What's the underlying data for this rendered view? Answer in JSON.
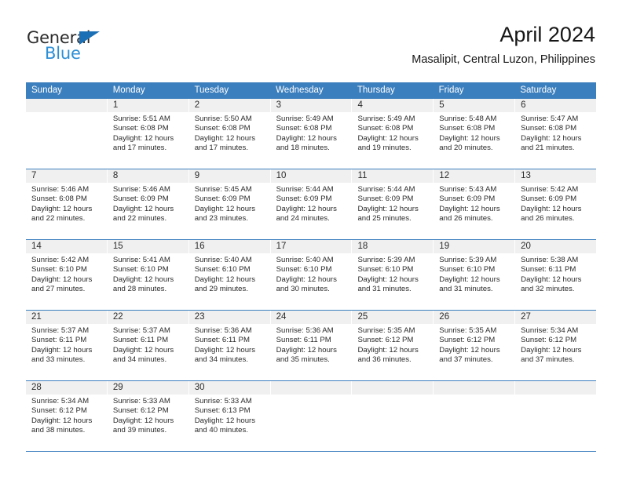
{
  "brand": {
    "name_dark": "General",
    "name_blue": "Blue",
    "accent_blue": "#2d8fd5",
    "triangle_blue": "#1a6fb5"
  },
  "header": {
    "title": "April 2024",
    "subtitle": "Masalipit, Central Luzon, Philippines"
  },
  "calendar": {
    "header_color": "#3c7fbe",
    "day_band_color": "#f0f0f0",
    "day_names": [
      "Sunday",
      "Monday",
      "Tuesday",
      "Wednesday",
      "Thursday",
      "Friday",
      "Saturday"
    ],
    "weeks": [
      [
        {
          "day": "",
          "empty": true,
          "sunrise": "",
          "sunset": "",
          "daylight": ""
        },
        {
          "day": "1",
          "empty": false,
          "sunrise": "Sunrise: 5:51 AM",
          "sunset": "Sunset: 6:08 PM",
          "daylight": "Daylight: 12 hours and 17 minutes."
        },
        {
          "day": "2",
          "empty": false,
          "sunrise": "Sunrise: 5:50 AM",
          "sunset": "Sunset: 6:08 PM",
          "daylight": "Daylight: 12 hours and 17 minutes."
        },
        {
          "day": "3",
          "empty": false,
          "sunrise": "Sunrise: 5:49 AM",
          "sunset": "Sunset: 6:08 PM",
          "daylight": "Daylight: 12 hours and 18 minutes."
        },
        {
          "day": "4",
          "empty": false,
          "sunrise": "Sunrise: 5:49 AM",
          "sunset": "Sunset: 6:08 PM",
          "daylight": "Daylight: 12 hours and 19 minutes."
        },
        {
          "day": "5",
          "empty": false,
          "sunrise": "Sunrise: 5:48 AM",
          "sunset": "Sunset: 6:08 PM",
          "daylight": "Daylight: 12 hours and 20 minutes."
        },
        {
          "day": "6",
          "empty": false,
          "sunrise": "Sunrise: 5:47 AM",
          "sunset": "Sunset: 6:08 PM",
          "daylight": "Daylight: 12 hours and 21 minutes."
        }
      ],
      [
        {
          "day": "7",
          "empty": false,
          "sunrise": "Sunrise: 5:46 AM",
          "sunset": "Sunset: 6:08 PM",
          "daylight": "Daylight: 12 hours and 22 minutes."
        },
        {
          "day": "8",
          "empty": false,
          "sunrise": "Sunrise: 5:46 AM",
          "sunset": "Sunset: 6:09 PM",
          "daylight": "Daylight: 12 hours and 22 minutes."
        },
        {
          "day": "9",
          "empty": false,
          "sunrise": "Sunrise: 5:45 AM",
          "sunset": "Sunset: 6:09 PM",
          "daylight": "Daylight: 12 hours and 23 minutes."
        },
        {
          "day": "10",
          "empty": false,
          "sunrise": "Sunrise: 5:44 AM",
          "sunset": "Sunset: 6:09 PM",
          "daylight": "Daylight: 12 hours and 24 minutes."
        },
        {
          "day": "11",
          "empty": false,
          "sunrise": "Sunrise: 5:44 AM",
          "sunset": "Sunset: 6:09 PM",
          "daylight": "Daylight: 12 hours and 25 minutes."
        },
        {
          "day": "12",
          "empty": false,
          "sunrise": "Sunrise: 5:43 AM",
          "sunset": "Sunset: 6:09 PM",
          "daylight": "Daylight: 12 hours and 26 minutes."
        },
        {
          "day": "13",
          "empty": false,
          "sunrise": "Sunrise: 5:42 AM",
          "sunset": "Sunset: 6:09 PM",
          "daylight": "Daylight: 12 hours and 26 minutes."
        }
      ],
      [
        {
          "day": "14",
          "empty": false,
          "sunrise": "Sunrise: 5:42 AM",
          "sunset": "Sunset: 6:10 PM",
          "daylight": "Daylight: 12 hours and 27 minutes."
        },
        {
          "day": "15",
          "empty": false,
          "sunrise": "Sunrise: 5:41 AM",
          "sunset": "Sunset: 6:10 PM",
          "daylight": "Daylight: 12 hours and 28 minutes."
        },
        {
          "day": "16",
          "empty": false,
          "sunrise": "Sunrise: 5:40 AM",
          "sunset": "Sunset: 6:10 PM",
          "daylight": "Daylight: 12 hours and 29 minutes."
        },
        {
          "day": "17",
          "empty": false,
          "sunrise": "Sunrise: 5:40 AM",
          "sunset": "Sunset: 6:10 PM",
          "daylight": "Daylight: 12 hours and 30 minutes."
        },
        {
          "day": "18",
          "empty": false,
          "sunrise": "Sunrise: 5:39 AM",
          "sunset": "Sunset: 6:10 PM",
          "daylight": "Daylight: 12 hours and 31 minutes."
        },
        {
          "day": "19",
          "empty": false,
          "sunrise": "Sunrise: 5:39 AM",
          "sunset": "Sunset: 6:10 PM",
          "daylight": "Daylight: 12 hours and 31 minutes."
        },
        {
          "day": "20",
          "empty": false,
          "sunrise": "Sunrise: 5:38 AM",
          "sunset": "Sunset: 6:11 PM",
          "daylight": "Daylight: 12 hours and 32 minutes."
        }
      ],
      [
        {
          "day": "21",
          "empty": false,
          "sunrise": "Sunrise: 5:37 AM",
          "sunset": "Sunset: 6:11 PM",
          "daylight": "Daylight: 12 hours and 33 minutes."
        },
        {
          "day": "22",
          "empty": false,
          "sunrise": "Sunrise: 5:37 AM",
          "sunset": "Sunset: 6:11 PM",
          "daylight": "Daylight: 12 hours and 34 minutes."
        },
        {
          "day": "23",
          "empty": false,
          "sunrise": "Sunrise: 5:36 AM",
          "sunset": "Sunset: 6:11 PM",
          "daylight": "Daylight: 12 hours and 34 minutes."
        },
        {
          "day": "24",
          "empty": false,
          "sunrise": "Sunrise: 5:36 AM",
          "sunset": "Sunset: 6:11 PM",
          "daylight": "Daylight: 12 hours and 35 minutes."
        },
        {
          "day": "25",
          "empty": false,
          "sunrise": "Sunrise: 5:35 AM",
          "sunset": "Sunset: 6:12 PM",
          "daylight": "Daylight: 12 hours and 36 minutes."
        },
        {
          "day": "26",
          "empty": false,
          "sunrise": "Sunrise: 5:35 AM",
          "sunset": "Sunset: 6:12 PM",
          "daylight": "Daylight: 12 hours and 37 minutes."
        },
        {
          "day": "27",
          "empty": false,
          "sunrise": "Sunrise: 5:34 AM",
          "sunset": "Sunset: 6:12 PM",
          "daylight": "Daylight: 12 hours and 37 minutes."
        }
      ],
      [
        {
          "day": "28",
          "empty": false,
          "sunrise": "Sunrise: 5:34 AM",
          "sunset": "Sunset: 6:12 PM",
          "daylight": "Daylight: 12 hours and 38 minutes."
        },
        {
          "day": "29",
          "empty": false,
          "sunrise": "Sunrise: 5:33 AM",
          "sunset": "Sunset: 6:12 PM",
          "daylight": "Daylight: 12 hours and 39 minutes."
        },
        {
          "day": "30",
          "empty": false,
          "sunrise": "Sunrise: 5:33 AM",
          "sunset": "Sunset: 6:13 PM",
          "daylight": "Daylight: 12 hours and 40 minutes."
        },
        {
          "day": "",
          "empty": true,
          "sunrise": "",
          "sunset": "",
          "daylight": ""
        },
        {
          "day": "",
          "empty": true,
          "sunrise": "",
          "sunset": "",
          "daylight": ""
        },
        {
          "day": "",
          "empty": true,
          "sunrise": "",
          "sunset": "",
          "daylight": ""
        },
        {
          "day": "",
          "empty": true,
          "sunrise": "",
          "sunset": "",
          "daylight": ""
        }
      ]
    ]
  }
}
